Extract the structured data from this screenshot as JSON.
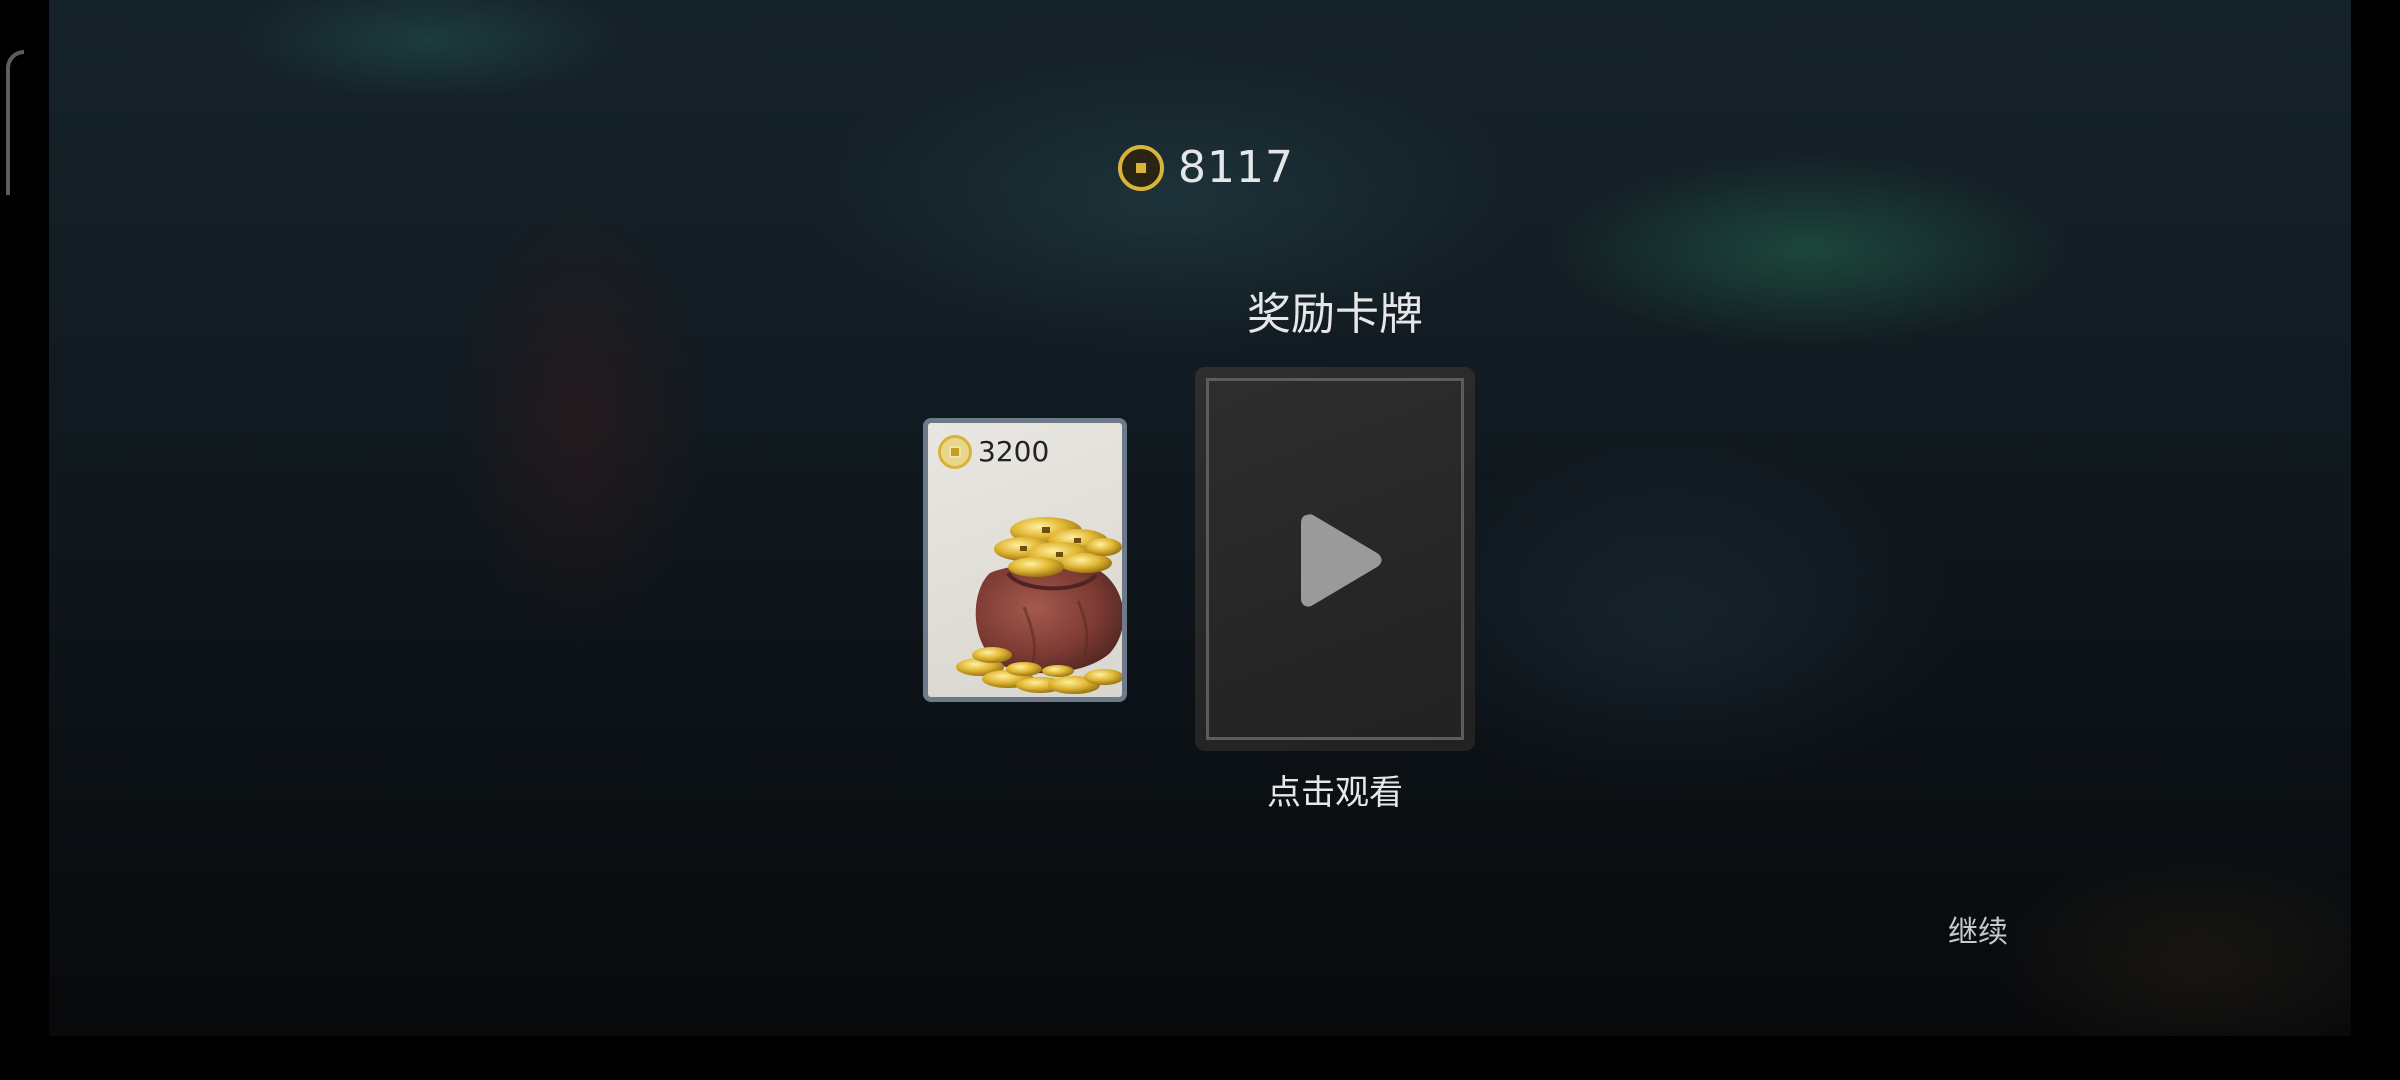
{
  "header": {
    "coin_icon": "coin-icon",
    "coin_balance": "8117"
  },
  "reward": {
    "title": "奖励卡牌",
    "card": {
      "price": "3200",
      "image": "coin-bag-illustration"
    },
    "video_card": {
      "icon": "play-icon",
      "caption": "点击观看"
    }
  },
  "footer": {
    "continue_label": "继续"
  },
  "colors": {
    "gold": "#d9b43a",
    "text": "#e7e7e7",
    "card_border": "#6c7a8a",
    "video_card_bg": "#2a2a2a"
  }
}
